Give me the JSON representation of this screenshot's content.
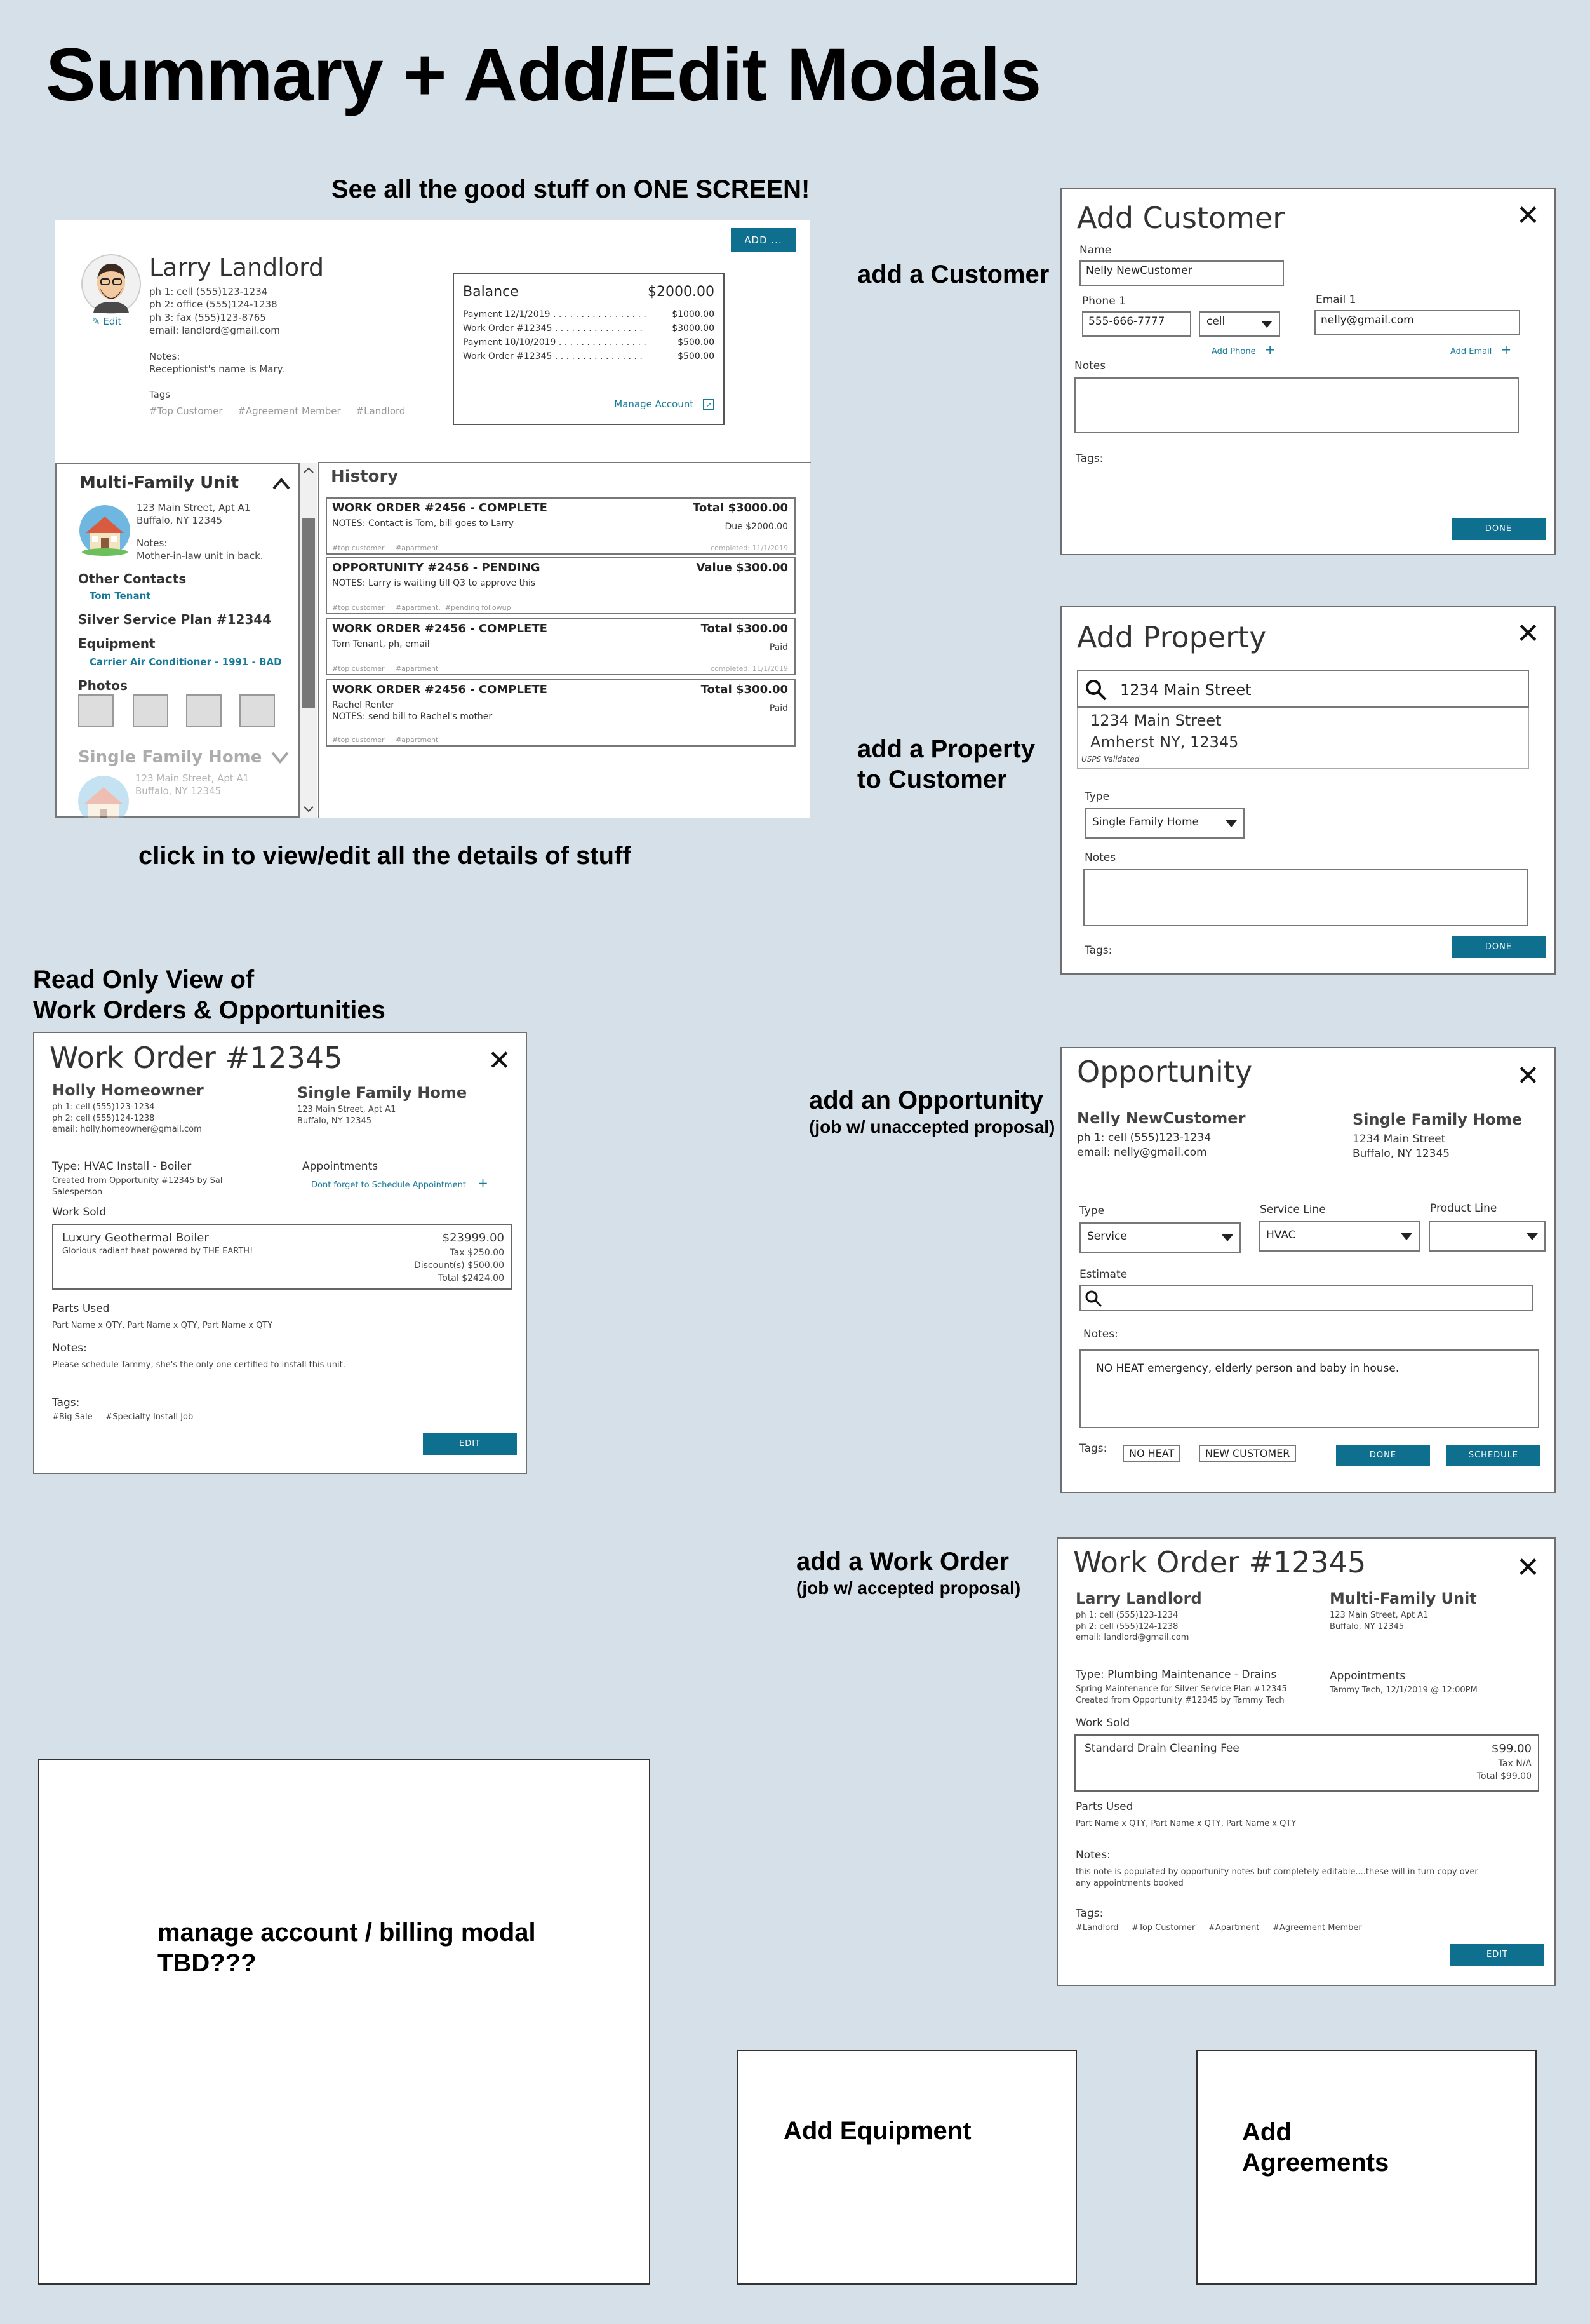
{
  "page": {
    "main_title": "Summary + Add/Edit Modals",
    "captions": {
      "summary": "See all the good stuff on ONE SCREEN!",
      "click_in": "click in to view/edit all the details of stuff",
      "read_only": "Read Only View of\nWork Orders & Opportunities",
      "add_customer": "add a Customer",
      "add_property": "add a Property\nto Customer",
      "add_opportunity": "add an Opportunity",
      "add_opportunity_sub": "(job w/ unaccepted proposal)",
      "add_work_order": "add a Work Order",
      "add_work_order_sub": "(job w/ accepted proposal)",
      "manage_account": "manage account / billing modal\nTBD???",
      "add_equipment": "Add Equipment",
      "add_agreements": "Add\nAgreements"
    }
  },
  "summary": {
    "add_button": "ADD ...",
    "customer": {
      "name": "Larry Landlord",
      "edit": "Edit",
      "contacts": "ph 1:   cell (555)123-1234\nph 2:   office (555)124-1238\nph 3:   fax (555)123-8765\nemail: landlord@gmail.com",
      "notes_label": "Notes:",
      "notes": "Receptionist's name is Mary.",
      "tags_label": "Tags",
      "tags": "#Top Customer     #Agreement Member     #Landlord"
    },
    "balance": {
      "label": "Balance",
      "amount": "$2000.00",
      "lines": [
        {
          "label": "Payment 12/1/2019 . . . . . . . . . . . . . . . . .",
          "amount": "$1000.00"
        },
        {
          "label": "Work Order #12345 . . . . . . . . . . . . . . . .",
          "amount": "$3000.00"
        },
        {
          "label": "Payment 10/10/2019 . . . . . . . . . . . . . . . .",
          "amount": "$500.00"
        },
        {
          "label": "Work Order #12345 . . . . . . . . . . . . . . . .",
          "amount": "$500.00"
        }
      ],
      "manage": "Manage Account"
    },
    "property": {
      "name": "Multi-Family Unit",
      "address": "123 Main Street, Apt A1\nBuffalo, NY 12345",
      "notes_label": "Notes:",
      "notes": "Mother-in-law unit in back.",
      "other_contacts_label": "Other Contacts",
      "other_contact": "Tom Tenant",
      "plan": "Silver Service Plan #12344",
      "equipment_label": "Equipment",
      "equipment": "Carrier Air Conditioner - 1991 - BAD",
      "photos_label": "Photos"
    },
    "property2": {
      "name": "Single Family Home",
      "address": "123 Main Street, Apt A1\nBuffalo, NY 12345"
    },
    "history": {
      "label": "History",
      "items": [
        {
          "title": "WORK ORDER #2456 - COMPLETE",
          "right": "Total $3000.00",
          "notes": "NOTES: Contact is Tom, bill goes to Larry",
          "sub": "Due $2000.00",
          "tags": "#top customer     #apartment",
          "completed": "completed: 11/1/2019"
        },
        {
          "title": "OPPORTUNITY #2456 - PENDING",
          "right": "Value $300.00",
          "notes": "NOTES: Larry is waiting till Q3 to approve this",
          "sub": "",
          "tags": "#top customer     #apartment,  #pending followup",
          "completed": ""
        },
        {
          "title": "WORK ORDER #2456 - COMPLETE",
          "right": "Total $300.00",
          "notes": "Tom Tenant, ph, email",
          "sub": "Paid",
          "tags": "#top customer     #apartment",
          "completed": "completed: 11/1/2019"
        },
        {
          "title": "WORK ORDER #2456 - COMPLETE",
          "right": "Total $300.00",
          "notes": "Rachel Renter\nNOTES: send bill to Rachel's mother",
          "sub": "Paid",
          "tags": "#top customer     #apartment",
          "completed": ""
        }
      ]
    }
  },
  "add_customer": {
    "title": "Add Customer",
    "name_label": "Name",
    "name_value": "Nelly NewCustomer",
    "phone_label": "Phone 1",
    "phone_value": "555-666-7777",
    "phone_type": "cell",
    "add_phone": "Add Phone",
    "email_label": "Email 1",
    "email_value": "nelly@gmail.com",
    "add_email": "Add Email",
    "notes_label": "Notes",
    "tags_label": "Tags:",
    "done": "DONE"
  },
  "add_property": {
    "title": "Add Property",
    "search_value": "1234 Main Street",
    "result_line1": "1234 Main Street",
    "result_line2": "Amherst NY, 12345",
    "validated": "USPS Validated",
    "type_label": "Type",
    "type_value": "Single Family Home",
    "notes_label": "Notes",
    "tags_label": "Tags:",
    "done": "DONE"
  },
  "opportunity": {
    "title": "Opportunity",
    "customer_name": "Nelly NewCustomer",
    "customer_details": "ph 1: cell (555)123-1234\nemail: nelly@gmail.com",
    "property_name": "Single Family Home",
    "property_address": "1234 Main Street\nBuffalo, NY 12345",
    "type_label": "Type",
    "type_value": "Service",
    "service_line_label": "Service Line",
    "service_line_value": "HVAC",
    "product_line_label": "Product Line",
    "estimate_label": "Estimate",
    "notes_label": "Notes:",
    "notes_value": "NO HEAT emergency, elderly person and baby in house.",
    "tags_label": "Tags:",
    "tags": [
      "NO HEAT",
      "NEW CUSTOMER"
    ],
    "done": "DONE",
    "schedule": "SCHEDULE"
  },
  "work_order_ro": {
    "title": "Work Order #12345",
    "customer_name": "Holly Homeowner",
    "customer_details": "ph 1: cell (555)123-1234\nph 2: cell (555)124-1238\nemail: holly.homeowner@gmail.com",
    "property_name": "Single Family Home",
    "property_address": "123 Main Street, Apt A1\nBuffalo, NY 12345",
    "type": "Type: HVAC Install - Boiler",
    "created": "Created from Opportunity #12345 by  Sal\nSalesperson",
    "appointments_label": "Appointments",
    "appointments_link": "Dont forget to Schedule Appointment",
    "work_sold_label": "Work Sold",
    "item_name": "Luxury Geothermal Boiler",
    "item_desc": "Glorious radiant heat powered by THE EARTH!",
    "item_price": "$23999.00",
    "item_tax": "Tax  $250.00",
    "item_discount": "Discount(s) $500.00",
    "item_total": "Total $2424.00",
    "parts_label": "Parts Used",
    "parts": "Part Name x QTY, Part Name x QTY, Part Name x QTY",
    "notes_label": "Notes:",
    "notes": "Please schedule Tammy, she's the only one certified to install this unit.",
    "tags_label": "Tags:",
    "tags": "#Big Sale     #Specialty Install Job",
    "edit": "EDIT"
  },
  "work_order_add": {
    "title": "Work Order #12345",
    "customer_name": "Larry Landlord",
    "customer_details": "ph 1: cell (555)123-1234\nph 2: cell (555)124-1238\nemail: landlord@gmail.com",
    "property_name": "Multi-Family Unit",
    "property_address": "123 Main Street, Apt A1\nBuffalo, NY 12345",
    "type": "Type: Plumbing Maintenance - Drains",
    "created": "Spring Maintenance for Silver Service Plan #12345\nCreated from Opportunity #12345 by Tammy Tech",
    "appointments_label": "Appointments",
    "appointments_value": "Tammy Tech, 12/1/2019 @ 12:00PM",
    "work_sold_label": "Work Sold",
    "item_name": "Standard Drain Cleaning Fee",
    "item_price": "$99.00",
    "item_tax": "Tax  N/A",
    "item_total": "Total $99.00",
    "parts_label": "Parts Used",
    "parts": "Part Name x QTY, Part Name x QTY, Part Name x QTY",
    "notes_label": "Notes:",
    "notes": "this note is populated by opportunity notes but completely editable....these will in turn copy over\nany appointments booked",
    "tags_label": "Tags:",
    "tags": "#Landlord     #Top Customer     #Apartment     #Agreement Member",
    "edit": "EDIT"
  },
  "icons": [
    "avatar",
    "pencil-icon",
    "external-link-icon",
    "chevron-up-icon",
    "chevron-down-icon",
    "house-icon",
    "close-icon",
    "search-icon",
    "plus-icon",
    "dropdown-arrow-icon"
  ],
  "colors": {
    "background": "#d6e0e8",
    "accent": "#0f6f8e",
    "link": "#167a98"
  }
}
